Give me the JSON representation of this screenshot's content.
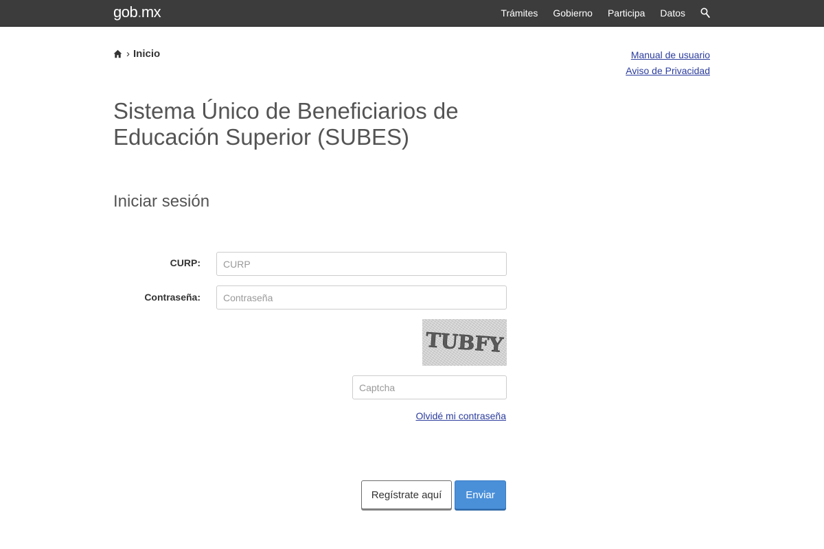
{
  "header": {
    "logo_main": "gob",
    "logo_dot": ".",
    "logo_suffix": "mx",
    "nav": [
      "Trámites",
      "Gobierno",
      "Participa",
      "Datos"
    ],
    "search_icon": "search-icon"
  },
  "breadcrumb": {
    "home_icon": "home-icon",
    "separator": "›",
    "current": "Inicio"
  },
  "toplinks": {
    "manual": "Manual de usuario",
    "privacy": "Aviso de Privacidad"
  },
  "page_title": "Sistema Único de Beneficiarios de Educación Superior (SUBES)",
  "section_title": "Iniciar sesión",
  "form": {
    "curp_label": "CURP:",
    "curp_placeholder": "CURP",
    "curp_value": "",
    "password_label": "Contraseña:",
    "password_placeholder": "Contraseña",
    "password_value": "",
    "captcha_text": "TUBFY",
    "captcha_placeholder": "Captcha",
    "captcha_value": "",
    "forgot_link": "Olvidé mi contraseña"
  },
  "buttons": {
    "register": "Regístrate aquí",
    "submit": "Enviar"
  },
  "colors": {
    "topbar": "#3c3c3c",
    "link": "#2b3c9d",
    "primary_button": "#4a90d9"
  }
}
